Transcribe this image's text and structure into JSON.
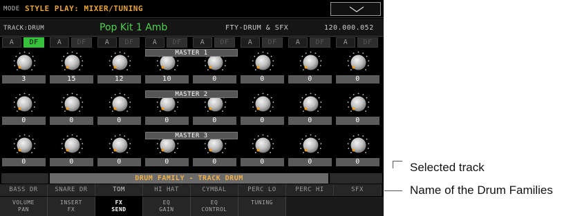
{
  "header": {
    "mode_label": "MODE",
    "mode_value": "STYLE PLAY: MIXER/TUNING"
  },
  "track": {
    "label": "TRACK:DRUM",
    "name": "Pop Kit 1 Amb",
    "kit": "FTY-DRUM & SFX",
    "code": "120.000.052"
  },
  "buttons": {
    "a_label": "A",
    "df_label": "DF",
    "df_active_index": 0
  },
  "masters": [
    "MASTER 1",
    "MASTER 2",
    "MASTER 3"
  ],
  "rows": [
    [
      "3",
      "15",
      "12",
      "10",
      "0",
      "0",
      "0",
      "0"
    ],
    [
      "0",
      "0",
      "0",
      "0",
      "0",
      "0",
      "0",
      "0"
    ],
    [
      "0",
      "0",
      "0",
      "0",
      "0",
      "0",
      "0",
      "0"
    ]
  ],
  "family_bar": "DRUM FAMILY - TRACK DRUM",
  "families": [
    "BASS DR",
    "SNARE DR",
    "TOM",
    "HI HAT",
    "CYMBAL",
    "PERC LO",
    "PERC HI",
    "SFX"
  ],
  "selected_family_index": 2,
  "tabs": [
    {
      "label": "VOLUME\nPAN"
    },
    {
      "label": "INSERT\nFX"
    },
    {
      "label": "FX\nSEND"
    },
    {
      "label": "EQ\nGAIN"
    },
    {
      "label": "EQ\nCONTROL"
    },
    {
      "label": "TUNING"
    }
  ],
  "selected_tab_index": 2,
  "callouts": {
    "selected_track": "Selected track",
    "drum_families": "Name of the Drum Families"
  },
  "colors": {
    "accent_orange": "#e8a33c",
    "active_green": "#35c23a",
    "track_name_green": "#4ed24e"
  }
}
